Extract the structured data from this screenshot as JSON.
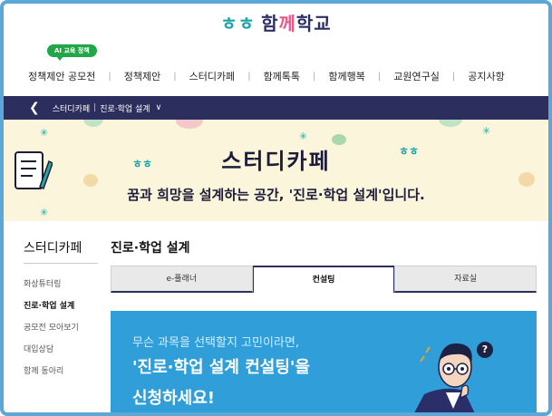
{
  "header": {
    "logo_mark": "ㅎㅎ",
    "logo_text_1": "함",
    "logo_text_2": "께",
    "logo_text_3": "학교",
    "ai_badge": "AI 교육 정책"
  },
  "topnav": {
    "items": [
      "정책제안 공모전",
      "정책제안",
      "스터디카페",
      "함께톡톡",
      "함께행복",
      "교원연구실",
      "공지사항"
    ]
  },
  "breadcrumb": {
    "back_icon": "chevron-left-icon",
    "section": "스터디카페",
    "page": "진로·학업 설계",
    "dropdown_icon": "chevron-down-icon"
  },
  "hero": {
    "hash": "ㅎㅎ",
    "title": "스터디카페",
    "subtitle": "꿈과 희망을 설계하는 공간, '진로·학업 설계'입니다."
  },
  "sidebar": {
    "title": "스터디카페",
    "items": [
      {
        "label": "화상튜터링",
        "active": false
      },
      {
        "label": "진로·학업 설계",
        "active": true
      },
      {
        "label": "공모전 모아보기",
        "active": false
      },
      {
        "label": "대입상담",
        "active": false
      },
      {
        "label": "함께 동아리",
        "active": false
      }
    ]
  },
  "main": {
    "title": "진로·학업 설계",
    "tabs": [
      {
        "label": "e-플래너",
        "active": false
      },
      {
        "label": "컨설팅",
        "active": true
      },
      {
        "label": "자료실",
        "active": false
      }
    ]
  },
  "banner": {
    "lead": "무슨 과목을 선택할지 고민이라면,",
    "line1": "'진로·학업 설계 컨설팅'을",
    "line2": "신청하세요!",
    "question_mark": "?"
  },
  "colors": {
    "frame": "#5aa7d8",
    "navy": "#2c2e5e",
    "hero_bg": "#fbf5dc",
    "banner_bg": "#2f9ed9",
    "badge_green": "#23a64a"
  }
}
